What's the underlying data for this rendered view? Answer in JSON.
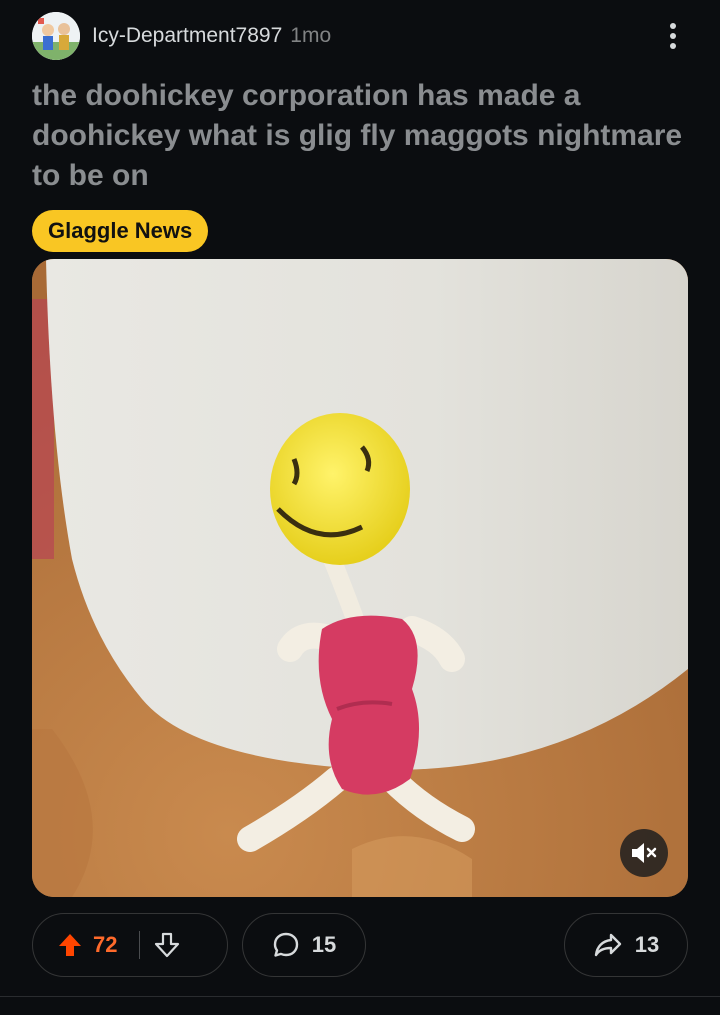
{
  "post": {
    "author": "Icy-Department7897",
    "age": "1mo",
    "title": "the doohickey corporation has made a doohickey what is glig fly maggots nightmare to be on",
    "flair": "Glaggle News",
    "flair_color": "#f9c623"
  },
  "media": {
    "type": "video",
    "muted": true
  },
  "actions": {
    "upvotes": "72",
    "comments": "15",
    "shares": "13",
    "upvote_color": "#ff4500"
  },
  "icons": {
    "more": "vertical-ellipsis-icon",
    "upvote": "upvote-arrow-icon",
    "downvote": "downvote-arrow-icon",
    "comment": "comment-bubble-icon",
    "share": "share-arrow-icon",
    "mute": "volume-muted-icon"
  }
}
